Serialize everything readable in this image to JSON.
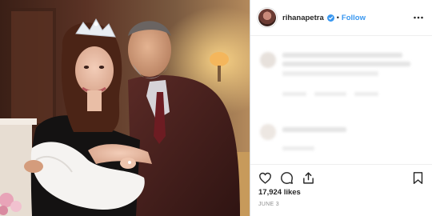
{
  "post": {
    "username": "rihanapetra",
    "separator": "•",
    "follow_label": "Follow",
    "likes_text": "17,924 likes",
    "date_text": "JUNE 3"
  },
  "colors": {
    "accent": "#3897f0",
    "text": "#262626",
    "muted": "#8e8e8e"
  },
  "icons": {
    "verified": "verified-badge-icon",
    "more": "more-options-icon",
    "like": "heart-icon",
    "comment": "comment-icon",
    "share": "share-icon",
    "save": "bookmark-icon"
  }
}
